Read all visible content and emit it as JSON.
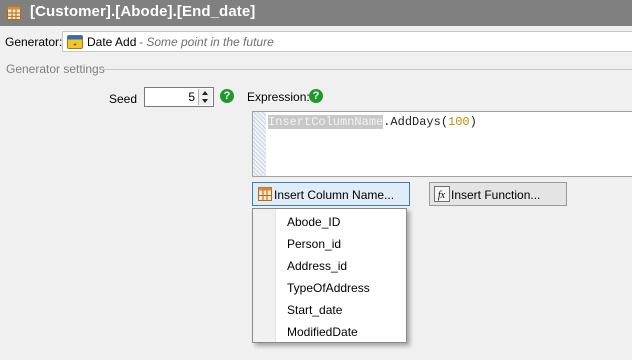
{
  "window": {
    "title": "[Customer].[Abode].[End_date]",
    "icon": "table-icon"
  },
  "generator": {
    "label": "Generator:",
    "icon": "date-add-icon",
    "name": "Date Add",
    "description": "- Some point in the future"
  },
  "settings": {
    "section_label": "Generator settings"
  },
  "seed": {
    "label": "Seed",
    "value": "5",
    "help_icon": "help-icon"
  },
  "expression": {
    "label": "Expression:",
    "help_icon": "help-icon",
    "code": {
      "column": "InsertColumnName",
      "method": ".AddDays(",
      "arg": "100",
      "close": ")"
    }
  },
  "buttons": {
    "insert_column": "Insert Column Name...",
    "insert_function": "Insert Function..."
  },
  "column_menu": {
    "items": [
      "Abode_ID",
      "Person_id",
      "Address_id",
      "TypeOfAddress",
      "Start_date",
      "ModifiedDate"
    ]
  },
  "colors": {
    "help_green": "#1e9a2c",
    "titlebar": "#808080",
    "number_token": "#c88a00"
  }
}
